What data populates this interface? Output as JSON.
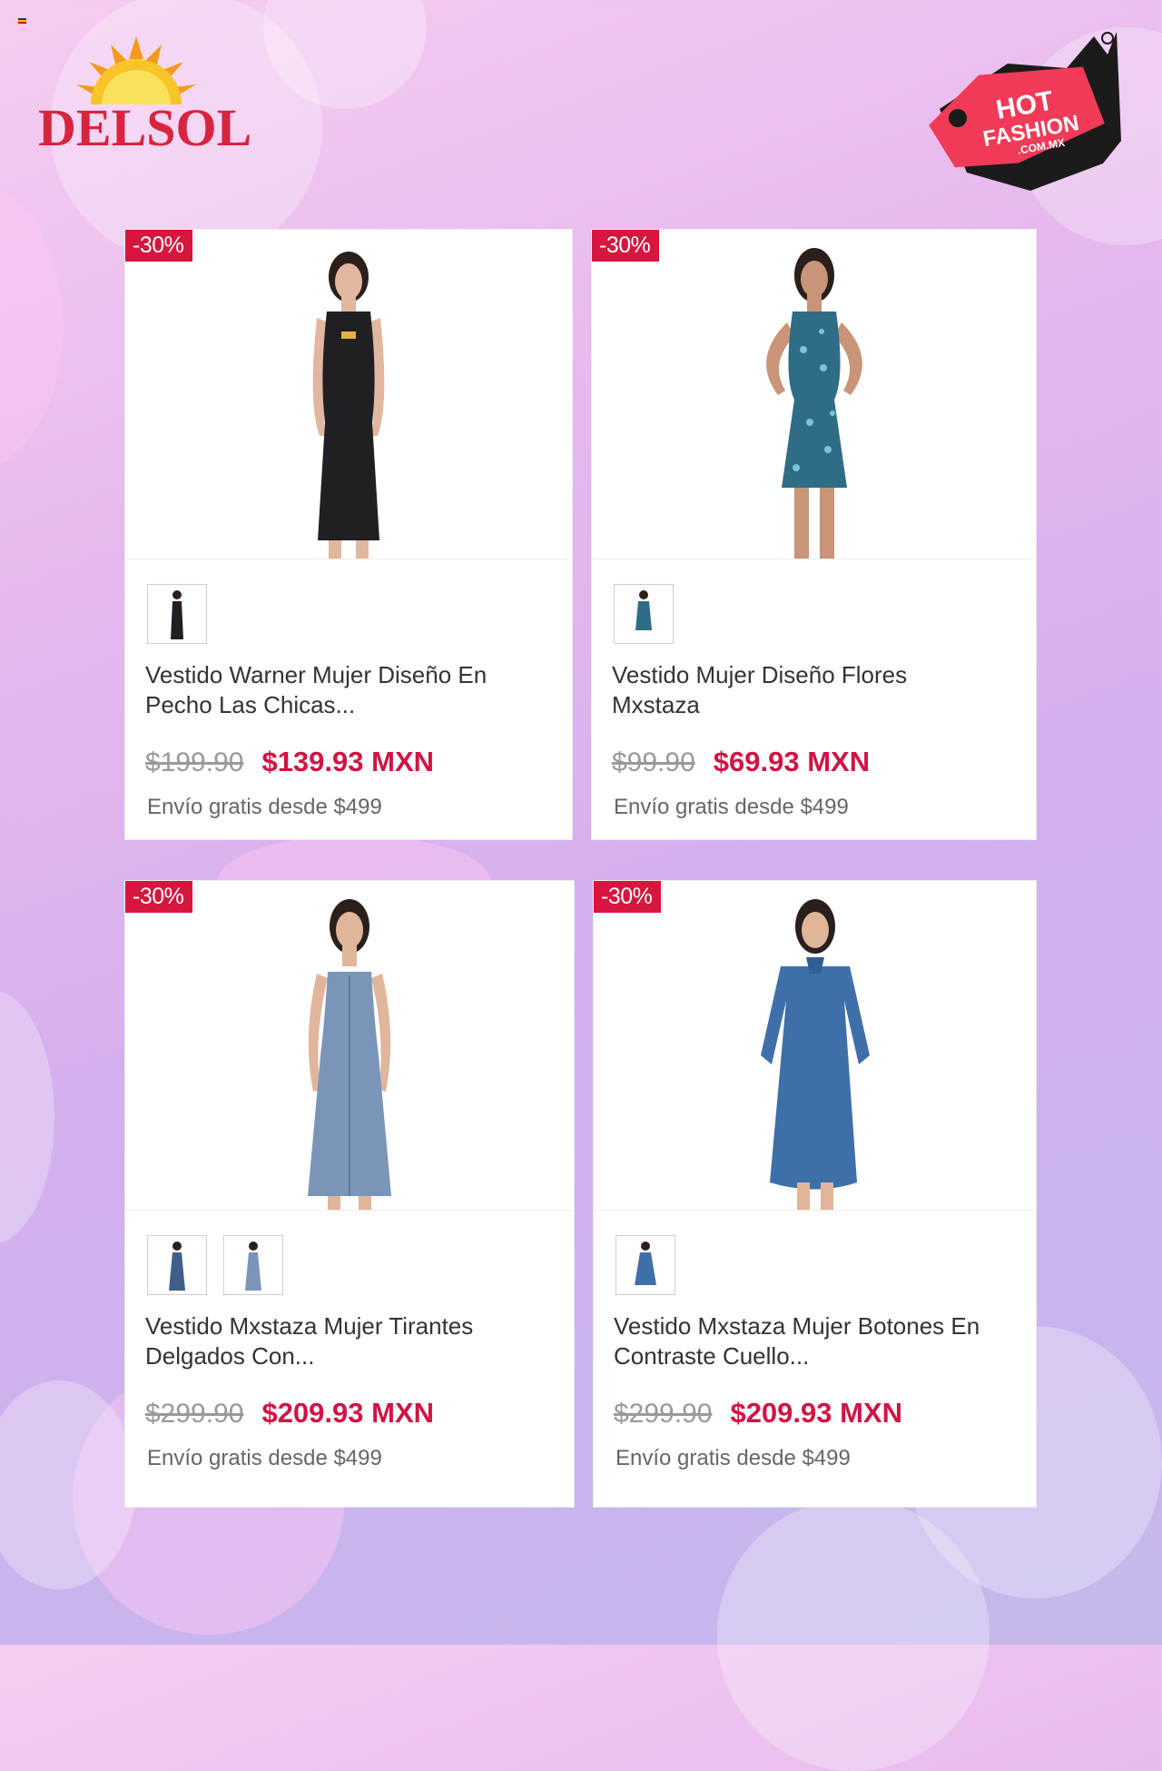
{
  "brand": {
    "left_logo": "DELSOL",
    "right_logo_line1": "HOT",
    "right_logo_line2": "FASHION",
    "right_logo_line3": ".COM.MX"
  },
  "colors": {
    "discount_badge": "#d6163d",
    "sale_price": "#d11443",
    "old_price": "#9a9a9a"
  },
  "products": [
    {
      "discount": "-30%",
      "title": "Vestido Warner Mujer Diseño En Pecho Las Chicas...",
      "old_price": "$199.90",
      "new_price": "$139.93 MXN",
      "shipping": "Envío gratis desde $499",
      "dress_color": "#1f1f24",
      "thumbnails": 1
    },
    {
      "discount": "-30%",
      "title": "Vestido Mujer Diseño Flores Mxstaza",
      "old_price": "$99.90",
      "new_price": "$69.93 MXN",
      "shipping": "Envío gratis desde $499",
      "dress_color": "#2f6d86",
      "thumbnails": 1
    },
    {
      "discount": "-30%",
      "title": "Vestido Mxstaza Mujer Tirantes Delgados Con...",
      "old_price": "$299.90",
      "new_price": "$209.93 MXN",
      "shipping": "Envío gratis desde $499",
      "dress_color": "#7a95b8",
      "thumbnails": 2
    },
    {
      "discount": "-30%",
      "title": "Vestido Mxstaza Mujer Botones En Contraste Cuello...",
      "old_price": "$299.90",
      "new_price": "$209.93 MXN",
      "shipping": "Envío gratis desde $499",
      "dress_color": "#3f6fa8",
      "thumbnails": 1
    }
  ]
}
